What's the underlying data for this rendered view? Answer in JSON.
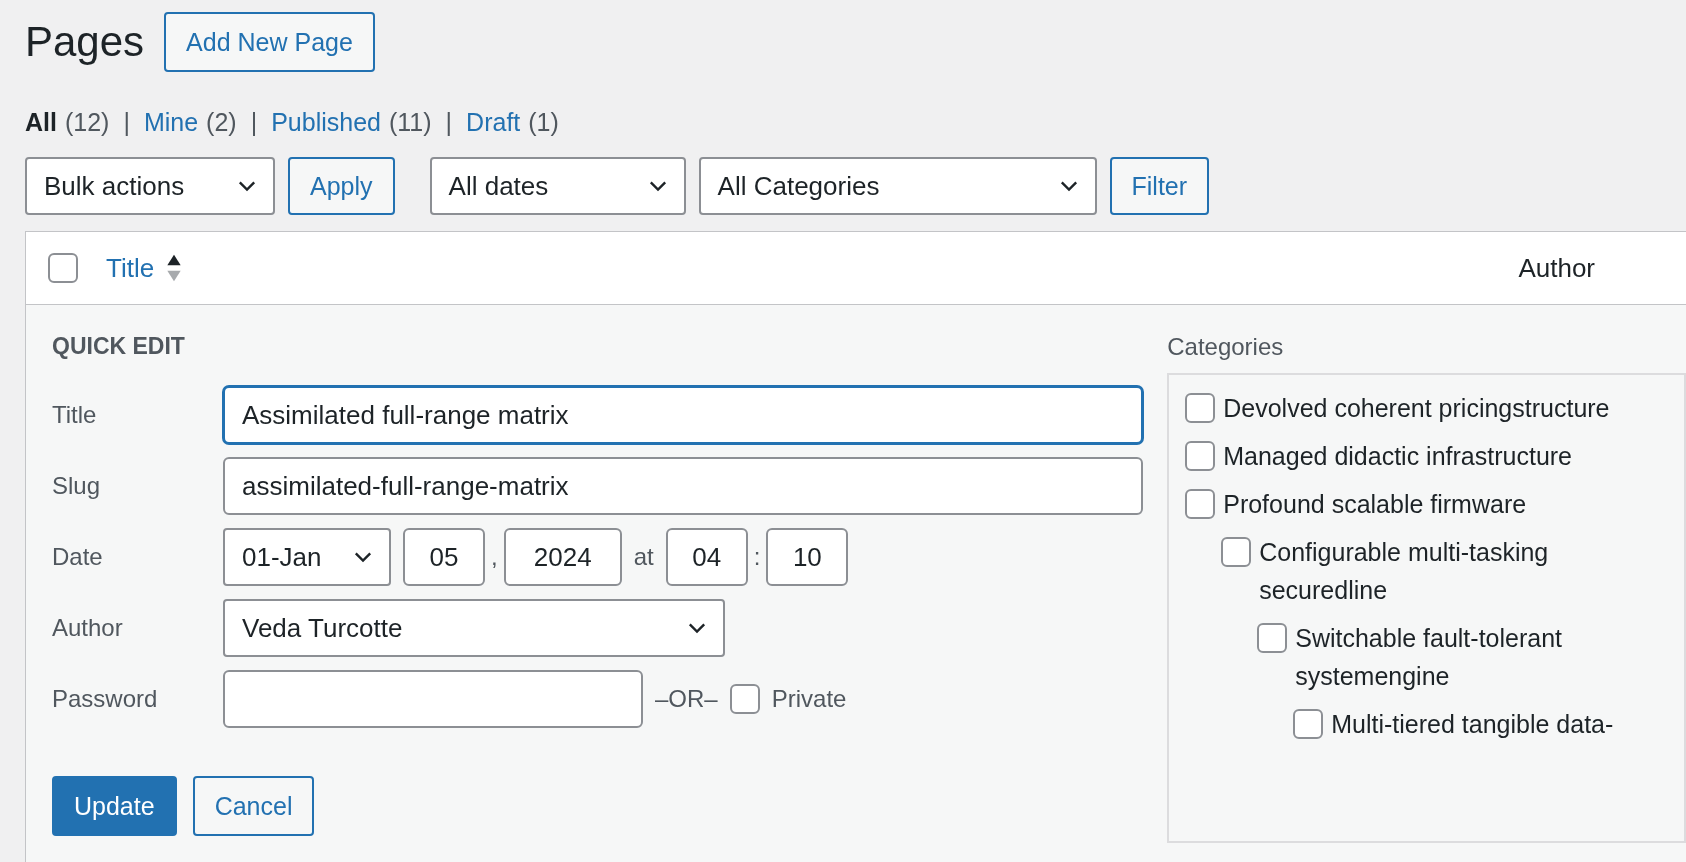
{
  "page_title": "Pages",
  "add_new_button": "Add New Page",
  "status_filters": [
    {
      "label": "All",
      "count": "(12)",
      "selected": true,
      "separator": "|"
    },
    {
      "label": "Mine",
      "count": "(2)",
      "selected": false,
      "separator": "|"
    },
    {
      "label": "Published",
      "count": "(11)",
      "selected": false,
      "separator": "|"
    },
    {
      "label": "Draft",
      "count": "(1)",
      "selected": false
    }
  ],
  "toolbar": {
    "bulk_actions": "Bulk actions",
    "apply_button": "Apply",
    "dates": "All dates",
    "categories": "All Categories",
    "filter_button": "Filter"
  },
  "table_header": {
    "select_all_checked": false,
    "title": "Title",
    "author": "Author"
  },
  "quick_edit": {
    "heading": "QUICK EDIT",
    "title": {
      "label": "Title",
      "value": "Assimilated full-range matrix",
      "focused": true
    },
    "slug": {
      "label": "Slug",
      "value": "assimilated-full-range-matrix",
      "focused": false
    },
    "date": {
      "label": "Date",
      "month": "01-Jan",
      "day": "05",
      "comma": ",",
      "year": "2024",
      "at": "at",
      "hour": "04",
      "colon": ":",
      "minute": "10"
    },
    "author": {
      "label": "Author",
      "value": "Veda Turcotte"
    },
    "password": {
      "label": "Password",
      "or": "–OR–",
      "private_label": "Private",
      "private_checked": false
    },
    "update_button": "Update",
    "cancel_button": "Cancel",
    "categories": {
      "label": "Categories",
      "items": [
        {
          "label": "Devolved coherent pricingstructure",
          "checked": false
        },
        {
          "label": "Managed didactic infrastructure",
          "checked": false
        },
        {
          "label": "Profound scalable firmware",
          "checked": false,
          "children": [
            {
              "label": "Configurable multi-tasking securedline",
              "checked": false,
              "children": [
                {
                  "label": "Switchable fault-tolerant systemengine",
                  "checked": false,
                  "children": [
                    {
                      "label": "Multi-tiered tangible data-",
                      "checked": false
                    }
                  ]
                }
              ]
            }
          ]
        }
      ]
    }
  }
}
